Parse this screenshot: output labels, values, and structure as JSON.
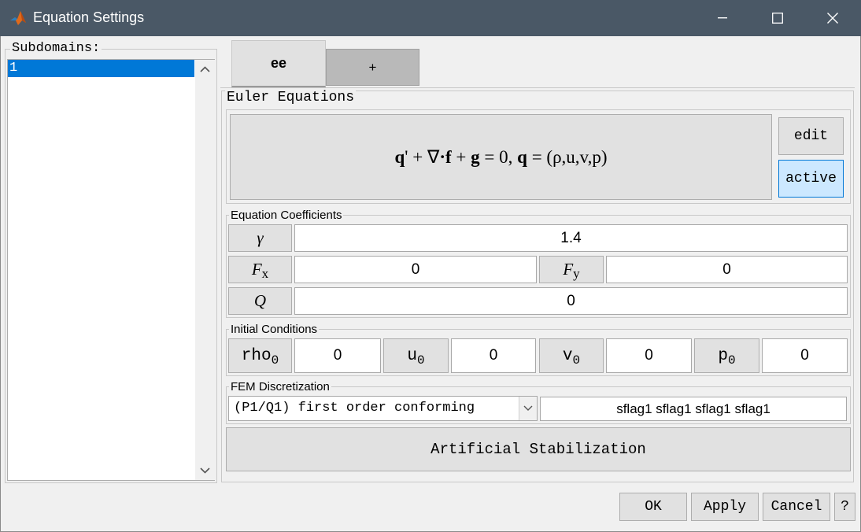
{
  "window": {
    "title": "Equation Settings",
    "icon": "matlab-icon"
  },
  "subdomains": {
    "label": "Subdomains:",
    "items": [
      "1"
    ],
    "selected_index": 0
  },
  "tabs": [
    {
      "label": "ee",
      "active": true
    },
    {
      "label": "+",
      "active": false
    }
  ],
  "equation_group": {
    "title": "Euler Equations",
    "formula": {
      "q": "q",
      "prime": "'",
      "plus1": " + ",
      "nabla": "∇",
      "dot": "·",
      "f": "f",
      "plus2": " + ",
      "g": "g",
      "eq_zero": " = 0, ",
      "q2": "q",
      "eq2": " = ",
      "tuple": "(ρ,u,v,p)"
    },
    "edit_label": "edit",
    "active_label": "active"
  },
  "coefficients": {
    "title": "Equation Coefficients",
    "gamma": {
      "symbol": "γ",
      "value": "1.4"
    },
    "fx": {
      "symbol": "F",
      "sub": "x",
      "value": "0"
    },
    "fy": {
      "symbol": "F",
      "sub": "y",
      "value": "0"
    },
    "q": {
      "symbol": "Q",
      "value": "0"
    }
  },
  "initial_conditions": {
    "title": "Initial Conditions",
    "items": [
      {
        "name": "rho",
        "sub": "0",
        "value": "0"
      },
      {
        "name": "u",
        "sub": "0",
        "value": "0"
      },
      {
        "name": "v",
        "sub": "0",
        "value": "0"
      },
      {
        "name": "p",
        "sub": "0",
        "value": "0"
      }
    ]
  },
  "fem": {
    "title": "FEM Discretization",
    "selected": "(P1/Q1) first order conforming",
    "sflags": "sflag1 sflag1 sflag1 sflag1"
  },
  "stabilization_label": "Artificial Stabilization",
  "footer": {
    "ok": "OK",
    "apply": "Apply",
    "cancel": "Cancel",
    "help": "?"
  },
  "colors": {
    "titlebar": "#4a5866",
    "selection": "#0078d7",
    "active_button": "#cce8ff",
    "active_border": "#0078d7"
  }
}
